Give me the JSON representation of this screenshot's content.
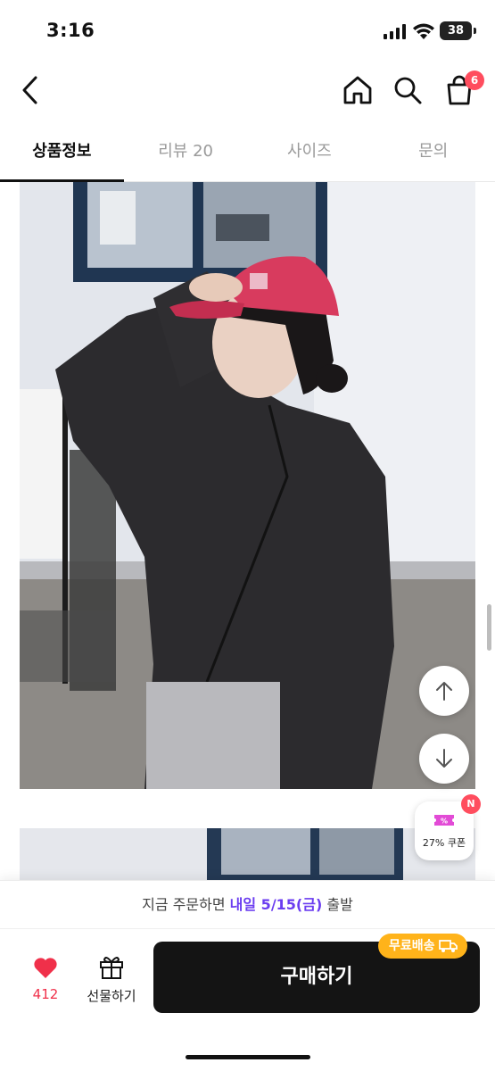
{
  "status_bar": {
    "time": "3:16",
    "battery": "38"
  },
  "nav": {
    "cart_badge": "6"
  },
  "tabs": [
    {
      "label": "상품정보",
      "active": true
    },
    {
      "label": "리뷰 20",
      "active": false
    },
    {
      "label": "사이즈",
      "active": false
    },
    {
      "label": "문의",
      "active": false
    }
  ],
  "coupon": {
    "label": "27% 쿠폰",
    "badge": "N"
  },
  "shipping": {
    "prefix": "지금 주문하면 ",
    "highlight": "내일 5/15(금)",
    "suffix": " 출발"
  },
  "bottom": {
    "like_count": "412",
    "gift_label": "선물하기",
    "buy_label": "구매하기",
    "free_shipping": "무료배송"
  },
  "colors": {
    "accent": "#6b3df0",
    "heart": "#f0304a",
    "badge": "#ff4d5e",
    "free_shipping": "#ffb31a",
    "buy_button": "#141414"
  },
  "icons": [
    "back-icon",
    "home-icon",
    "search-icon",
    "shopping-bag-icon",
    "arrow-up-icon",
    "arrow-down-icon",
    "coupon-icon",
    "heart-icon",
    "gift-icon",
    "truck-icon"
  ]
}
